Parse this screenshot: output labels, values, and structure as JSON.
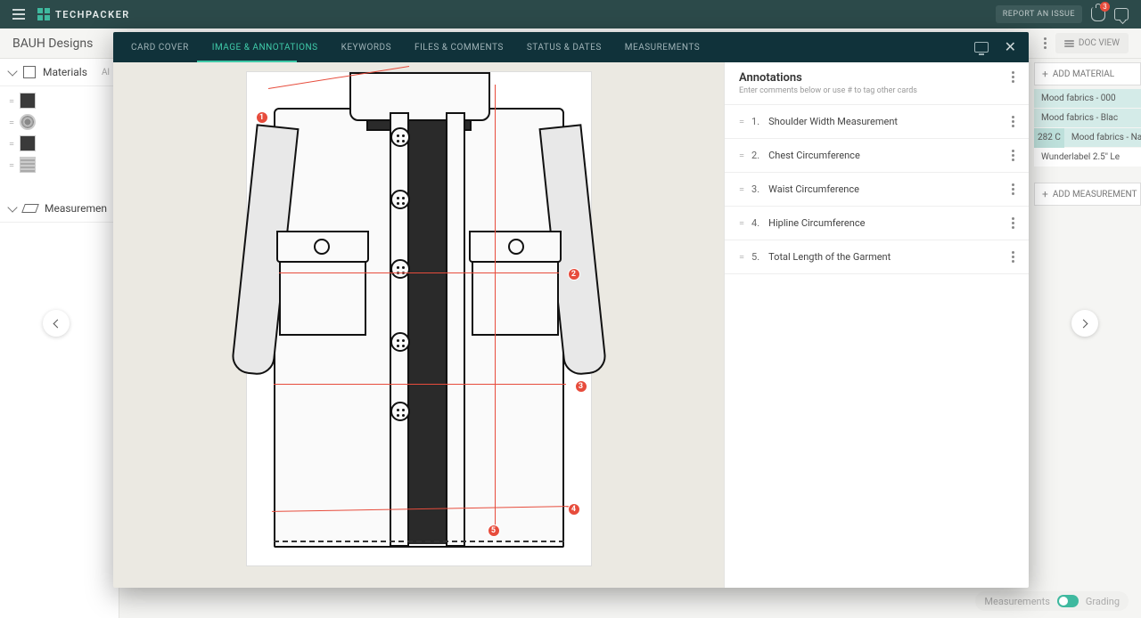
{
  "topbar": {
    "brand": "TECHPACKER",
    "report": "REPORT AN ISSUE",
    "notif_count": "3"
  },
  "secbar": {
    "project": "BAUH Designs",
    "doc_view": "DOC VIEW"
  },
  "sidebar": {
    "materials_title": "Materials",
    "materials_badge": "Al",
    "measurements_title": "Measuremen"
  },
  "right_bg": {
    "add_material": "ADD MATERIAL",
    "add_measurement": "ADD MEASUREMENT",
    "chips": [
      "Mood fabrics -  000",
      "Mood fabrics -  Blac",
      "Mood fabrics -  Navy",
      "Wunderlabel 2.5\" Le"
    ],
    "chip_badge": "282 C"
  },
  "modal": {
    "tabs": {
      "card_cover": "CARD COVER",
      "image_annotations": "IMAGE & ANNOTATIONS",
      "keywords": "KEYWORDS",
      "files_comments": "FILES & COMMENTS",
      "status_dates": "STATUS & DATES",
      "measurements": "MEASUREMENTS"
    },
    "markers": {
      "m1": "1",
      "m2": "2",
      "m3": "3",
      "m4": "4",
      "m5": "5"
    }
  },
  "annotations": {
    "title": "Annotations",
    "subtitle": "Enter comments below or use # to tag other cards",
    "items": [
      {
        "n": "1.",
        "label": "Shoulder Width Measurement"
      },
      {
        "n": "2.",
        "label": "Chest Circumference"
      },
      {
        "n": "3.",
        "label": "Waist Circumference"
      },
      {
        "n": "4.",
        "label": "Hipline Circumference"
      },
      {
        "n": "5.",
        "label": "Total Length of the Garment"
      }
    ]
  },
  "footer": {
    "left": "Measurements",
    "right": "Grading"
  }
}
